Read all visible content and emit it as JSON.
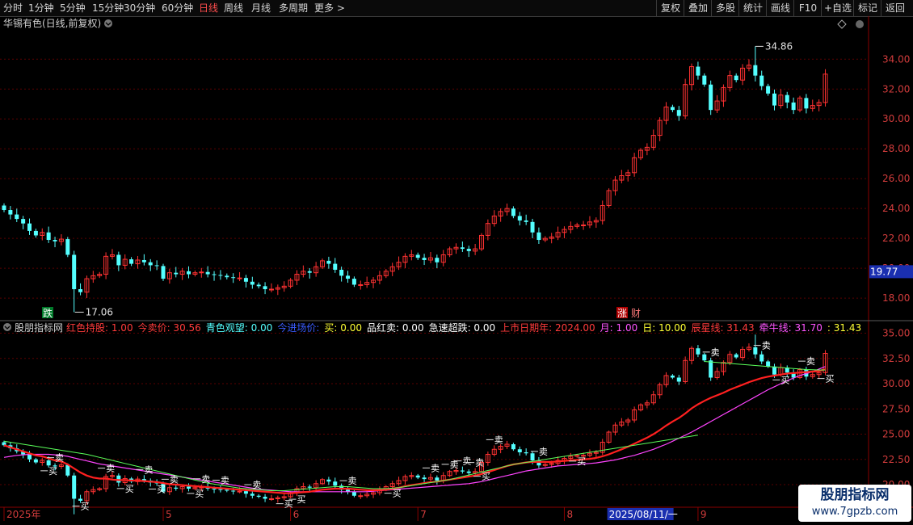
{
  "toolbar": {
    "periods": [
      "分时",
      "1分钟",
      "5分钟",
      "15分钟",
      "30分钟",
      "60分钟",
      "日线",
      "周线",
      "月线",
      "多周期",
      "更多 >"
    ],
    "active_period": "日线",
    "right_buttons": [
      "复权",
      "叠加",
      "多股",
      "统计",
      "画线",
      "F10",
      "+自选",
      "标记",
      "返回"
    ]
  },
  "colors": {
    "up": "#ff3232",
    "down": "#54ffff",
    "grid": "#5a0000",
    "axis": "#8a0000",
    "white": "#e0e0e0"
  },
  "main_panel": {
    "title": "华锡有色(日线,前复权)",
    "ylim": [
      16.6,
      35.8
    ],
    "ticks": [
      18.0,
      20.0,
      22.0,
      24.0,
      26.0,
      28.0,
      30.0,
      32.0,
      34.0
    ],
    "tick_labels": [
      "18.00",
      "20.00",
      "22.00",
      "24.00",
      "26.00",
      "28.00",
      "30.00",
      "32.00",
      "34.00"
    ],
    "current_price": "19.77",
    "max_label": "34.86",
    "min_label": "17.06",
    "marker_down": "跌",
    "marker_zhang": "涨",
    "marker_cai": "财"
  },
  "sub_panel": {
    "title": "股朋指标网",
    "ylim": [
      19.6,
      35.6
    ],
    "ticks": [
      20.0,
      22.5,
      25.0,
      27.5,
      30.0,
      32.5,
      35.0
    ],
    "tick_labels": [
      "20.00",
      "22.50",
      "25.00",
      "27.50",
      "30.00",
      "32.50",
      "35.00"
    ],
    "legend": [
      {
        "text": "红色持股: 1.00",
        "color": "#ff3b3b"
      },
      {
        "text": "今卖价: 30.56",
        "color": "#ff3b3b"
      },
      {
        "text": "青色观望: 0.00",
        "color": "#54ffff"
      },
      {
        "text": "今进场价:",
        "color": "#3a5cff"
      },
      {
        "text": "买: 0.00",
        "color": "#ffff33"
      },
      {
        "text": "品红卖: 0.00",
        "color": "#ffffff"
      },
      {
        "text": "急速超跌: 0.00",
        "color": "#ffffff"
      },
      {
        "text": "上市日期年: 2024.00",
        "color": "#ff3b3b"
      },
      {
        "text": "月: 1.00",
        "color": "#ff55ff"
      },
      {
        "text": "日: 10.00",
        "color": "#ffff33"
      },
      {
        "text": "辰星线: 31.43",
        "color": "#ff3b3b"
      },
      {
        "text": "牵牛线: 31.70",
        "color": "#ff55ff"
      },
      {
        "text": ": 31.43",
        "color": "#ffff33"
      },
      {
        "text": ": 31.43",
        "color": "#ff3b3b"
      },
      {
        "text": ": 31.7",
        "color": "#ff3b3b"
      }
    ],
    "buy": "买",
    "sell": "卖"
  },
  "x_axis": {
    "labels": [
      {
        "i": 0,
        "text": "2025年"
      },
      {
        "i": 25,
        "text": "5"
      },
      {
        "i": 45,
        "text": "6"
      },
      {
        "i": 65,
        "text": "7"
      },
      {
        "i": 88,
        "text": "8"
      },
      {
        "i": 95,
        "text": "2025/08/11/一"
      },
      {
        "i": 109,
        "text": "9"
      }
    ]
  },
  "watermark": {
    "line1": "股朋指标网",
    "line2": "www.7gpzb.com"
  },
  "chart_data": {
    "type": "candlestick",
    "closes": [
      23.9,
      23.6,
      23.3,
      23.0,
      22.5,
      22.2,
      22.4,
      21.9,
      21.8,
      21.95,
      20.9,
      18.6,
      18.4,
      19.3,
      19.5,
      19.6,
      20.8,
      20.9,
      20.2,
      20.6,
      20.3,
      20.55,
      20.4,
      20.2,
      20.15,
      19.3,
      19.7,
      19.6,
      19.8,
      19.6,
      19.7,
      19.75,
      19.6,
      19.55,
      19.5,
      19.4,
      19.35,
      19.35,
      19.1,
      18.9,
      18.8,
      18.6,
      18.6,
      18.7,
      18.8,
      19.2,
      19.6,
      19.8,
      19.7,
      20.1,
      20.5,
      20.3,
      19.9,
      19.5,
      19.3,
      18.9,
      18.9,
      19.05,
      19.2,
      19.5,
      19.8,
      20.1,
      20.4,
      20.8,
      20.9,
      20.7,
      20.55,
      20.7,
      20.4,
      20.9,
      21.3,
      21.4,
      21.3,
      21.15,
      21.3,
      22.2,
      23.0,
      23.5,
      23.8,
      24.0,
      23.5,
      23.2,
      23.1,
      22.4,
      21.9,
      22.0,
      22.1,
      22.4,
      22.6,
      22.8,
      22.9,
      22.9,
      23.1,
      23.2,
      24.2,
      25.2,
      25.9,
      26.2,
      26.4,
      27.4,
      27.9,
      28.1,
      28.9,
      29.9,
      30.8,
      30.6,
      30.2,
      32.3,
      33.5,
      32.9,
      32.3,
      30.6,
      31.2,
      32.1,
      32.9,
      32.6,
      33.4,
      33.6,
      32.9,
      32.2,
      31.7,
      30.9,
      31.6,
      31.1,
      30.6,
      31.4,
      30.7,
      30.9,
      31.1,
      33.0
    ],
    "ma_red": [
      23.9,
      23.7,
      23.5,
      23.3,
      23.1,
      22.9,
      22.8,
      22.6,
      22.4,
      22.3,
      22.0,
      21.6,
      21.2,
      20.9,
      20.7,
      20.6,
      20.6,
      20.5,
      20.45,
      20.45,
      20.4,
      20.4,
      20.35,
      20.3,
      20.25,
      20.15,
      20.05,
      20.0,
      19.95,
      19.9,
      19.85,
      19.8,
      19.75,
      19.7,
      19.65,
      19.6,
      19.55,
      19.5,
      19.45,
      19.4,
      19.35,
      19.3,
      19.25,
      19.2,
      19.15,
      19.15,
      19.2,
      19.25,
      19.3,
      19.4,
      19.5,
      19.55,
      19.6,
      19.6,
      19.6,
      19.55,
      19.5,
      19.45,
      19.45,
      19.45,
      19.5,
      19.6,
      19.7,
      19.85,
      19.95,
      20.05,
      20.15,
      20.25,
      20.3,
      20.4,
      20.5,
      20.6,
      20.7,
      20.8,
      20.9,
      21.05,
      21.25,
      21.45,
      21.65,
      21.85,
      22.0,
      22.1,
      22.2,
      22.25,
      22.25,
      22.25,
      22.25,
      22.3,
      22.35,
      22.4,
      22.45,
      22.5,
      22.55,
      22.65,
      22.8,
      23.0,
      23.25,
      23.5,
      23.75,
      24.05,
      24.35,
      24.65,
      25.0,
      25.4,
      25.85,
      26.25,
      26.6,
      27.05,
      27.55,
      27.95,
      28.3,
      28.6,
      28.85,
      29.1,
      29.4,
      29.65,
      29.9,
      30.15,
      30.35,
      30.55,
      30.7,
      30.8,
      30.9,
      31.0,
      31.05,
      31.1,
      31.15,
      31.2,
      31.25,
      31.43
    ],
    "ma_magenta": [
      22.7,
      22.8,
      22.9,
      22.95,
      23.0,
      23.0,
      23.0,
      23.0,
      22.95,
      22.9,
      22.8,
      22.65,
      22.5,
      22.35,
      22.2,
      22.05,
      21.95,
      21.85,
      21.75,
      21.65,
      21.55,
      21.45,
      21.35,
      21.25,
      21.15,
      21.05,
      20.95,
      20.85,
      20.75,
      20.65,
      20.55,
      20.45,
      20.35,
      20.25,
      20.15,
      20.05,
      19.95,
      19.85,
      19.75,
      19.65,
      19.55,
      19.5,
      19.45,
      19.4,
      19.35,
      19.3,
      19.3,
      19.3,
      19.3,
      19.3,
      19.3,
      19.3,
      19.3,
      19.3,
      19.3,
      19.3,
      19.3,
      19.3,
      19.35,
      19.4,
      19.45,
      19.5,
      19.55,
      19.6,
      19.65,
      19.7,
      19.75,
      19.8,
      19.85,
      19.9,
      19.95,
      20.0,
      20.05,
      20.1,
      20.2,
      20.3,
      20.45,
      20.6,
      20.75,
      20.9,
      21.05,
      21.2,
      21.35,
      21.45,
      21.55,
      21.65,
      21.75,
      21.85,
      21.9,
      21.95,
      22.0,
      22.05,
      22.1,
      22.15,
      22.25,
      22.35,
      22.45,
      22.6,
      22.75,
      22.9,
      23.1,
      23.3,
      23.5,
      23.75,
      24.0,
      24.3,
      24.6,
      24.9,
      25.2,
      25.55,
      25.9,
      26.25,
      26.6,
      26.95,
      27.3,
      27.65,
      28.0,
      28.35,
      28.7,
      29.05,
      29.4,
      29.7,
      30.0,
      30.3,
      30.55,
      30.8,
      31.0,
      31.2,
      31.45,
      31.7
    ],
    "ma_green": [
      24.3,
      24.2,
      24.1,
      24.0,
      23.9,
      23.8,
      23.7,
      23.6,
      23.5,
      23.4,
      23.3,
      23.2,
      23.1,
      23.0,
      22.85,
      22.7,
      22.55,
      22.4,
      22.25,
      22.1,
      21.95,
      21.8,
      21.65,
      21.5,
      21.35,
      21.2,
      21.05,
      20.9,
      20.75,
      20.6,
      20.45,
      20.3,
      20.15,
      20.05,
      19.95,
      19.85,
      19.75,
      19.65,
      19.6,
      19.55,
      19.5,
      19.45,
      19.4,
      19.4,
      19.4,
      19.45,
      19.5,
      19.55,
      19.6,
      19.65,
      19.7,
      19.75,
      19.8,
      19.8,
      19.8,
      19.75,
      19.7,
      19.65,
      19.6,
      19.6,
      19.6,
      19.65,
      19.7,
      19.8,
      19.9,
      20.0,
      20.1,
      20.2,
      20.3,
      20.4,
      20.5,
      20.65,
      20.8,
      20.95,
      21.1,
      21.25,
      21.4,
      21.55,
      21.7,
      21.85,
      22.0,
      22.1,
      22.2,
      22.3,
      22.4,
      22.5,
      22.6,
      22.7,
      22.8,
      22.9,
      23.0,
      23.1,
      23.2,
      23.3,
      23.4,
      23.5,
      23.6,
      23.7,
      23.8,
      23.9,
      24.0,
      24.1,
      24.2,
      24.3,
      24.4,
      24.5,
      24.6,
      24.7,
      24.8,
      24.9,
      32.2,
      32.15,
      32.1,
      32.05,
      32.0,
      31.95,
      31.9,
      31.85,
      31.8,
      31.75,
      31.7,
      31.65,
      31.6,
      31.55,
      31.5,
      31.45,
      31.4,
      31.38,
      31.36,
      31.35
    ],
    "buy_signals": [
      7,
      12,
      19,
      24,
      30,
      44,
      46,
      61,
      75,
      90,
      122,
      129
    ],
    "sell_signals": [
      8,
      16,
      22,
      26,
      31,
      34,
      39,
      54,
      67,
      70,
      72,
      74,
      77,
      84,
      111,
      119,
      126
    ]
  }
}
